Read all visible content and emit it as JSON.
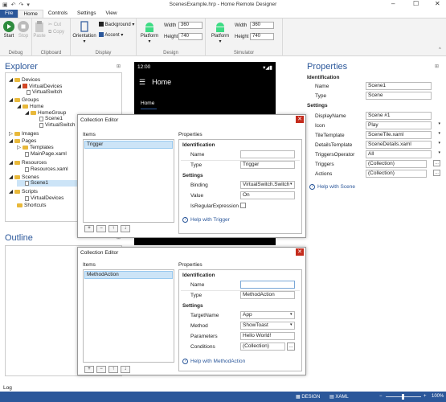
{
  "window": {
    "title": "ScenesExample.hrp - Home Remote Designer",
    "controls": [
      "–",
      "☐",
      "✕"
    ]
  },
  "ribbon_tabs": [
    "File",
    "Home",
    "Controls",
    "Settings",
    "View"
  ],
  "ribbon": {
    "debug": {
      "start": "Start",
      "stop": "Stop",
      "label": "Debug"
    },
    "clipboard": {
      "paste": "Paste",
      "cut": "Cut",
      "copy": "Copy",
      "label": "Clipboard"
    },
    "display": {
      "orientation": "Orientation",
      "background": "Background",
      "accent": "Accent",
      "label": "Display"
    },
    "design": {
      "platform": "Platform",
      "width_label": "Width",
      "width_value": "360",
      "height_label": "Height",
      "height_value": "740",
      "label": "Design"
    },
    "simulator": {
      "platform": "Platform",
      "width_label": "Width",
      "width_value": "360",
      "height_label": "Height",
      "height_value": "740",
      "label": "Simulator"
    }
  },
  "explorer": {
    "title": "Explorer",
    "items": [
      "Devices",
      "VirtualDevices",
      "VirtualSwitch",
      "Groups",
      "Home",
      "HomeGroup",
      "Scene1",
      "VirtualSwitch",
      "Images",
      "Pages",
      "Templates",
      "MainPage.xaml",
      "Resources",
      "Resources.xaml",
      "Scenes",
      "Scene1",
      "Scripts",
      "VirtualDevices",
      "Shortcuts"
    ]
  },
  "outline": {
    "title": "Outline"
  },
  "phone": {
    "time": "12:00",
    "title": "Home",
    "tab": "Home"
  },
  "properties": {
    "title": "Properties",
    "identification": "Identification",
    "name_label": "Name",
    "name_value": "Scene1",
    "type_label": "Type",
    "type_value": "Scene",
    "settings": "Settings",
    "rows": [
      {
        "label": "DisplayName",
        "value": "Scene #1"
      },
      {
        "label": "Icon",
        "value": "Play"
      },
      {
        "label": "TileTemplate",
        "value": "SceneTile.xaml"
      },
      {
        "label": "DetailsTemplate",
        "value": "SceneDetails.xaml"
      },
      {
        "label": "TriggersOperator",
        "value": "All"
      },
      {
        "label": "Triggers",
        "value": "(Collection)"
      },
      {
        "label": "Actions",
        "value": "(Collection)"
      }
    ],
    "help": "Help with Scene"
  },
  "dialog1": {
    "title": "Collection Editor",
    "items_label": "Items",
    "selected_item": "Trigger",
    "properties_label": "Properties",
    "identification": "Identification",
    "name_label": "Name",
    "name_value": "",
    "type_label": "Type",
    "type_value": "Trigger",
    "settings": "Settings",
    "binding_label": "Binding",
    "binding_value": "VirtualSwitch.Switch",
    "value_label": "Value",
    "value_value": "On",
    "regex_label": "IsRegularExpression",
    "help": "Help with Trigger",
    "buttons": [
      "+",
      "−",
      "↑",
      "↓"
    ]
  },
  "dialog2": {
    "title": "Collection Editor",
    "items_label": "Items",
    "selected_item": "MethodAction",
    "properties_label": "Properties",
    "identification": "Identification",
    "name_label": "Name",
    "name_value": "",
    "type_label": "Type",
    "type_value": "MethodAction",
    "settings": "Settings",
    "target_label": "TargetName",
    "target_value": "App",
    "method_label": "Method",
    "method_value": "ShowToast",
    "params_label": "Parameters",
    "params_value": "Hello World!",
    "conditions_label": "Conditions",
    "conditions_value": "(Collection)",
    "help": "Help with MethodAction",
    "buttons": [
      "+",
      "−",
      "↑",
      "↓"
    ]
  },
  "log": {
    "label": "Log"
  },
  "status": {
    "design": "DESIGN",
    "xaml": "XAML",
    "zoom": "100%"
  },
  "colors": {
    "accent": "#2b579a",
    "close": "#c42b1c",
    "android": "#3ddc84"
  }
}
